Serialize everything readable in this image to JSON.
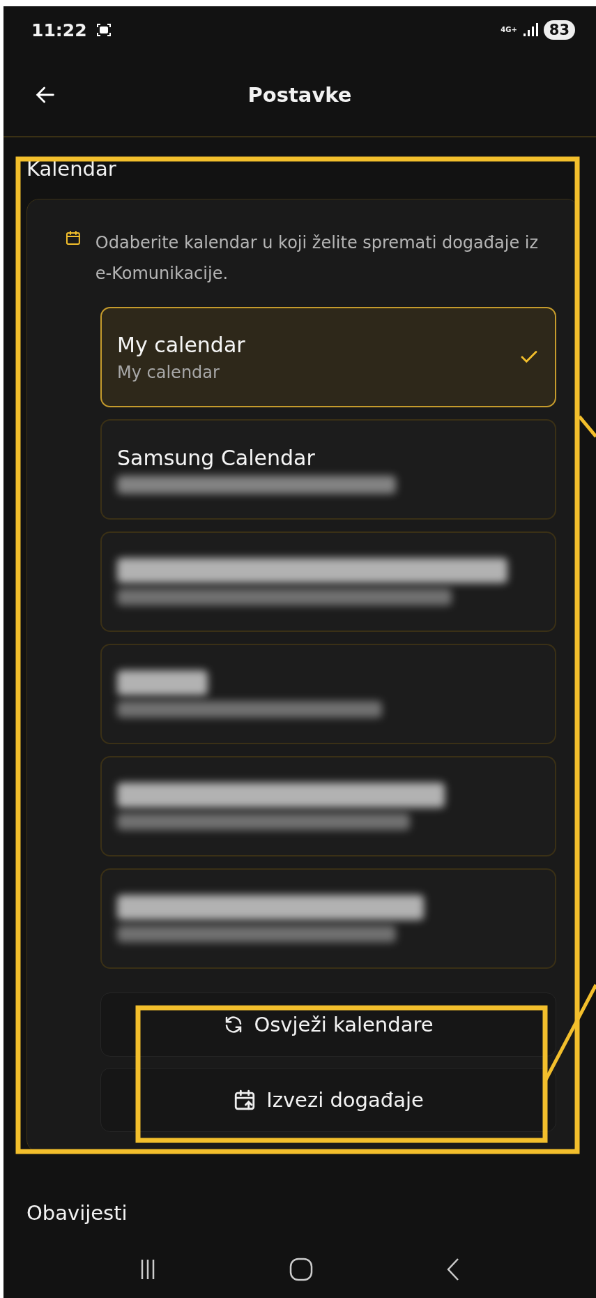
{
  "status_bar": {
    "time": "11:22",
    "network": "4G+",
    "battery": "83"
  },
  "header": {
    "title": "Postavke"
  },
  "section": {
    "title": "Kalendar",
    "description": "Odaberite kalendar u koji želite spremati događaje iz e-Komunikacije.",
    "calendars": [
      {
        "kind": "named",
        "title": "My calendar",
        "subtitle": "My calendar",
        "selected": true
      },
      {
        "kind": "named_redacted",
        "title": "Samsung Calendar",
        "selected": false
      },
      {
        "kind": "redacted",
        "selected": false
      },
      {
        "kind": "redacted",
        "selected": false
      },
      {
        "kind": "redacted",
        "selected": false
      },
      {
        "kind": "redacted",
        "selected": false
      }
    ],
    "buttons": [
      {
        "kind": "refresh",
        "label": "Osvježi kalendare"
      },
      {
        "kind": "export",
        "label": "Izvezi događaje"
      }
    ]
  },
  "next_section": {
    "title": "Obavijesti"
  }
}
